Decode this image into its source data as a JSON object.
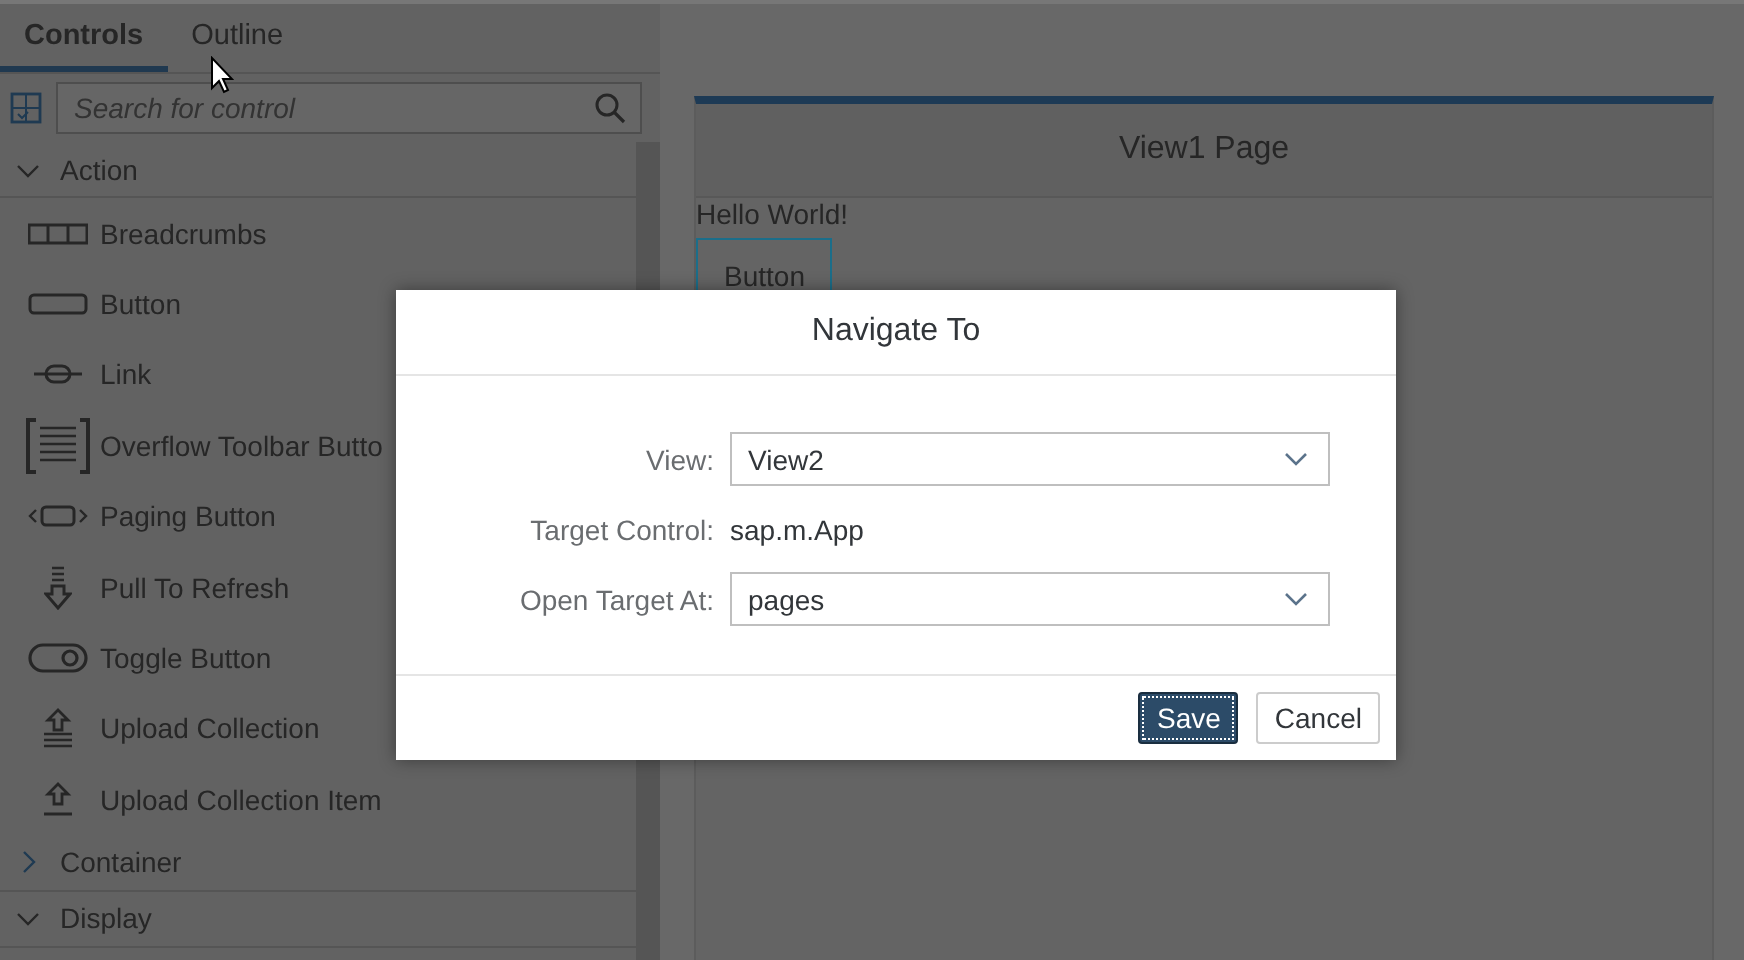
{
  "tabs": [
    {
      "label": "Controls",
      "selected": true
    },
    {
      "label": "Outline",
      "selected": false
    }
  ],
  "search": {
    "placeholder": "Search for control"
  },
  "groups": [
    {
      "label": "Action",
      "expanded": true,
      "items": [
        {
          "label": "Breadcrumbs",
          "kind": "breadcrumbs"
        },
        {
          "label": "Button",
          "kind": "button"
        },
        {
          "label": "Link",
          "kind": "link"
        },
        {
          "label": "Overflow Toolbar Butto",
          "kind": "overflow"
        },
        {
          "label": "Paging Button",
          "kind": "paging"
        },
        {
          "label": "Pull To Refresh",
          "kind": "pull"
        },
        {
          "label": "Toggle Button",
          "kind": "toggle"
        },
        {
          "label": "Upload Collection",
          "kind": "upload-list"
        },
        {
          "label": "Upload Collection Item",
          "kind": "upload"
        }
      ]
    },
    {
      "label": "Container",
      "expanded": false
    },
    {
      "label": "Display",
      "expanded": true
    }
  ],
  "canvas": {
    "page_title": "View1 Page",
    "text": "Hello World!",
    "button": "Button"
  },
  "dialog": {
    "title": "Navigate To",
    "fields": [
      {
        "kind": "select",
        "label": "View:",
        "value": "View2"
      },
      {
        "kind": "text",
        "label": "Target Control:",
        "value": "sap.m.App"
      },
      {
        "kind": "select",
        "label": "Open Target At:",
        "value": "pages"
      }
    ],
    "buttons": [
      {
        "label": "Save",
        "kind": "primary"
      },
      {
        "label": "Cancel",
        "kind": "secondary"
      }
    ]
  }
}
